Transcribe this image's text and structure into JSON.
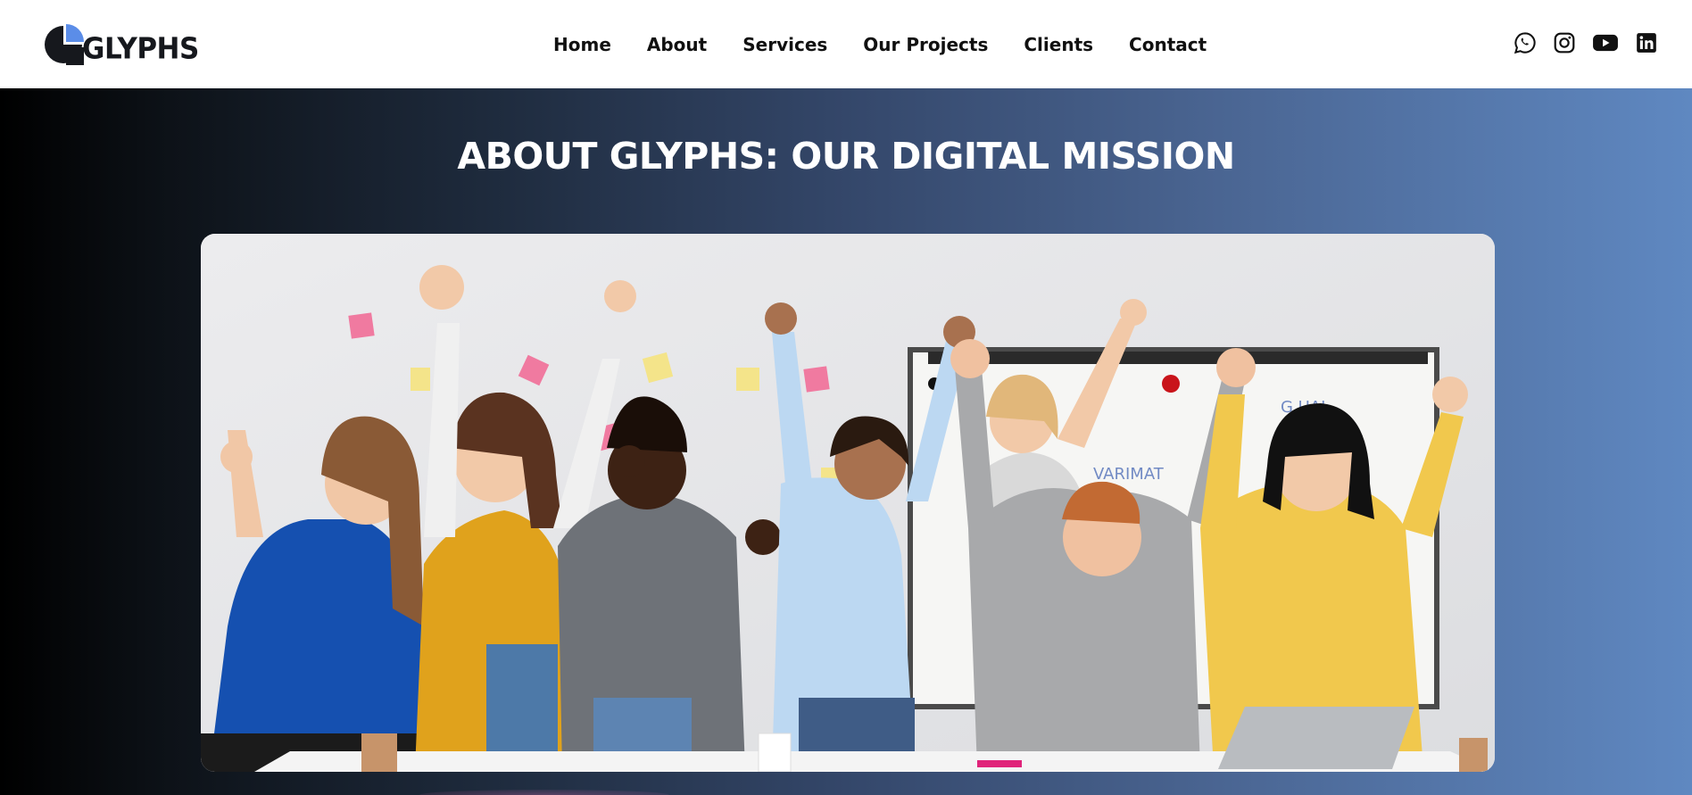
{
  "header": {
    "logo_text": "GLYPHS",
    "logo_icon": "glyphs-logo-mark",
    "nav": [
      {
        "label": "Home"
      },
      {
        "label": "About"
      },
      {
        "label": "Services"
      },
      {
        "label": "Our Projects"
      },
      {
        "label": "Clients"
      },
      {
        "label": "Contact"
      }
    ],
    "social": [
      {
        "icon": "whatsapp-icon"
      },
      {
        "icon": "instagram-icon"
      },
      {
        "icon": "youtube-icon"
      },
      {
        "icon": "linkedin-icon"
      }
    ]
  },
  "hero": {
    "title": "ABOUT GLYPHS: OUR DIGITAL MISSION",
    "image_subject": "team-celebrating-photo"
  },
  "colors": {
    "header_bg": "#ffffff",
    "nav_text": "#111111",
    "logo_accent": "#5b8de8",
    "logo_dark": "#16181d",
    "hero_gradient_start": "#000000",
    "hero_gradient_end": "#5f88c1",
    "hero_title": "#ffffff"
  }
}
